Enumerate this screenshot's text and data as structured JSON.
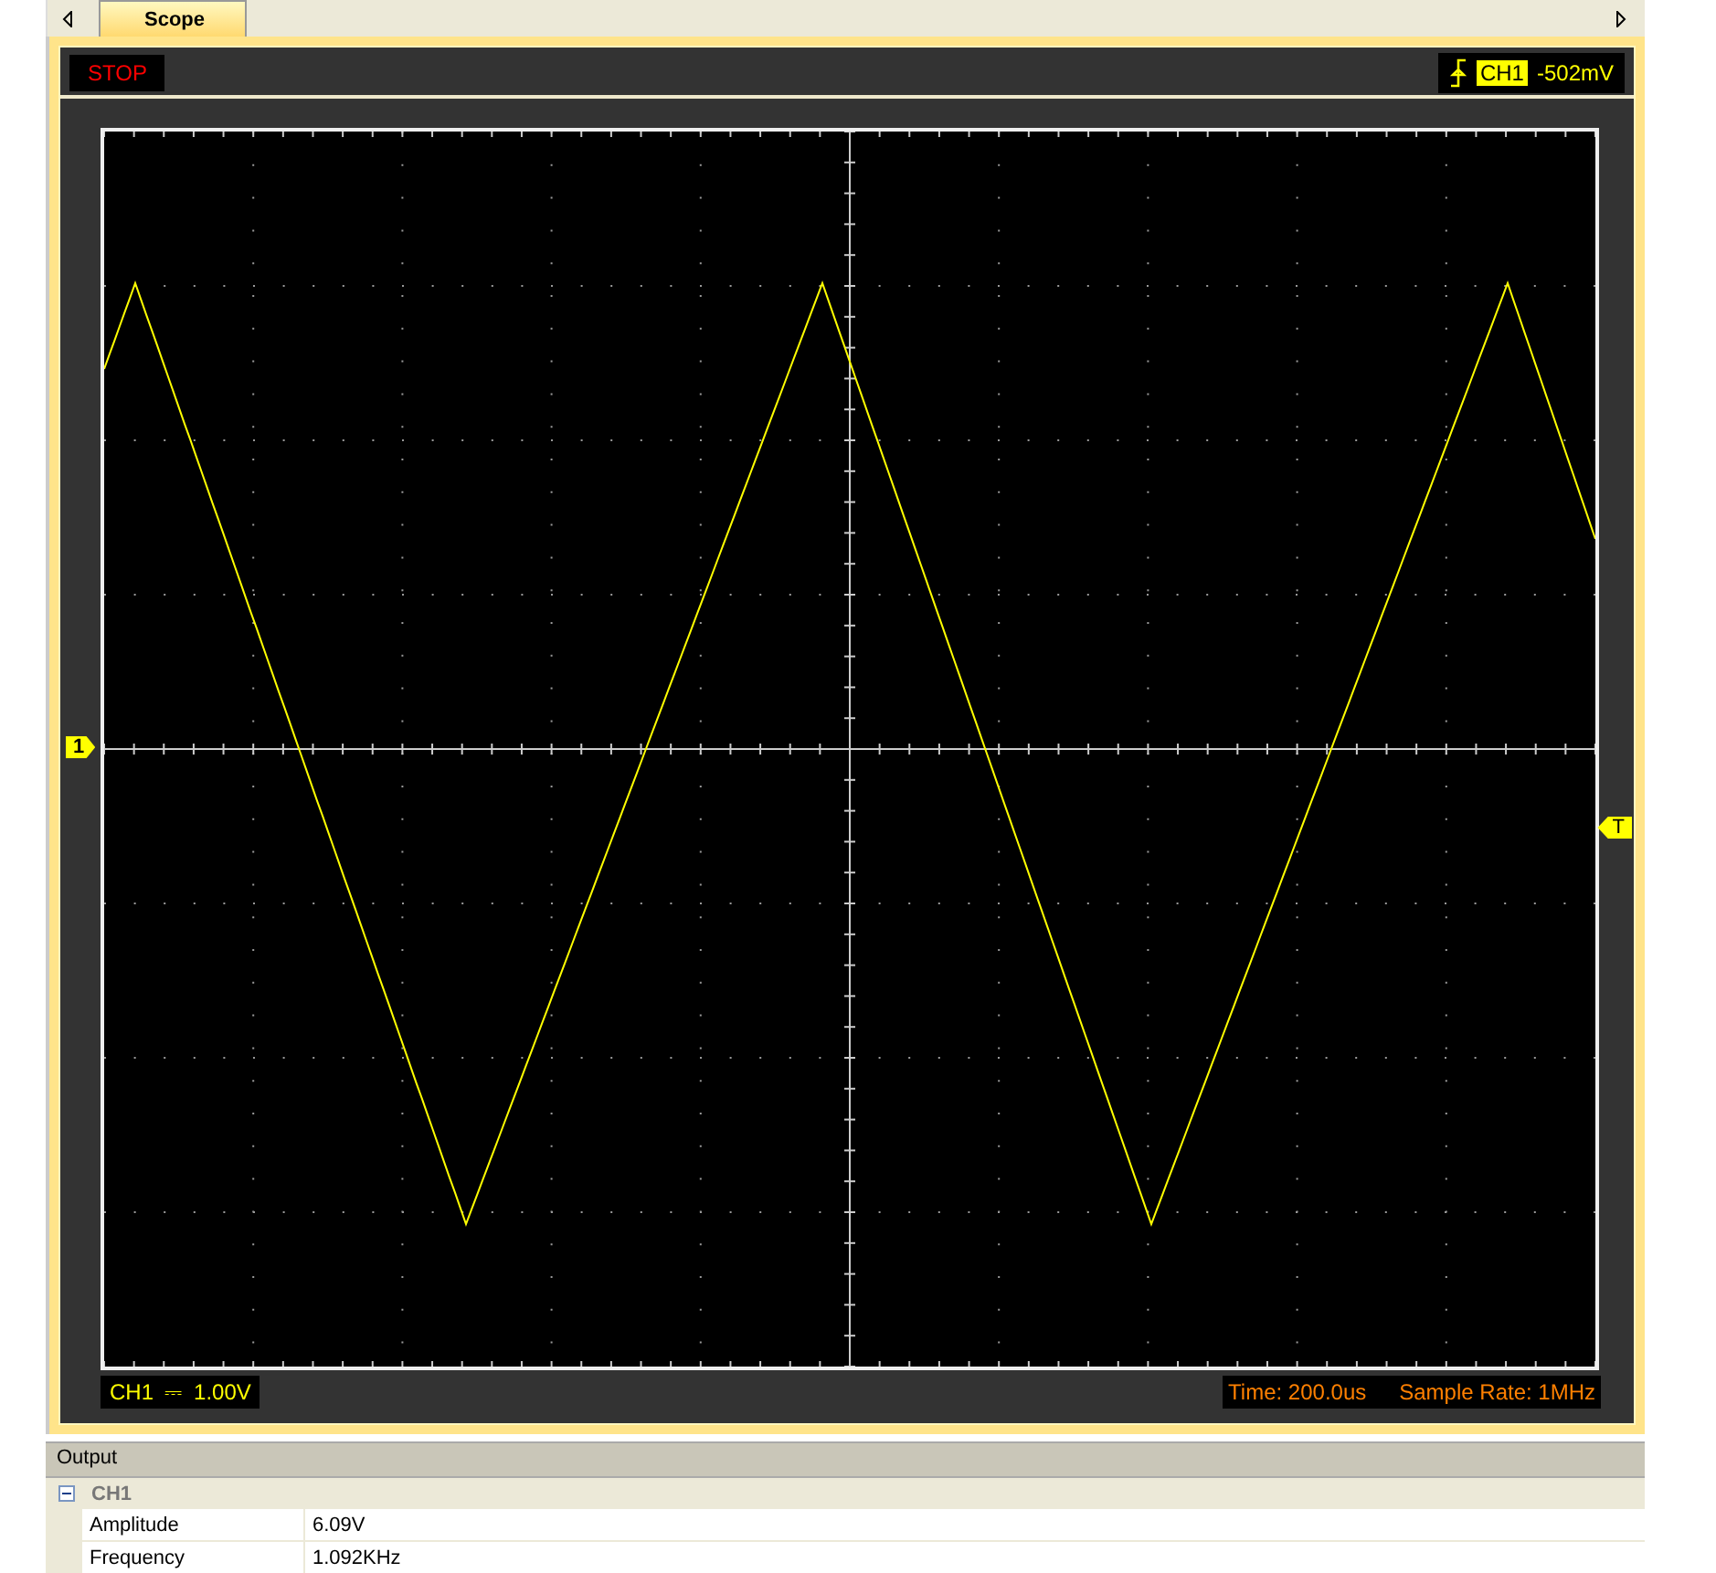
{
  "tabs": [
    {
      "label": "Scope",
      "selected": true
    }
  ],
  "status": {
    "run_state": "STOP"
  },
  "trigger": {
    "channel": "CH1",
    "level": "-502mV"
  },
  "markers": {
    "channel": "1",
    "trigger": "T"
  },
  "channel_scale": {
    "channel": "CH1",
    "coupling": "⎓",
    "volts_per_div": "1.00V"
  },
  "timebase": "Time: 200.0us",
  "sample_rate": "Sample Rate: 1MHz",
  "output": {
    "title": "Output",
    "groups": [
      {
        "name": "CH1",
        "expanded": true,
        "rows": [
          {
            "label": "Amplitude",
            "value": "6.09V"
          },
          {
            "label": "Frequency",
            "value": "1.092KHz"
          }
        ]
      }
    ]
  }
}
